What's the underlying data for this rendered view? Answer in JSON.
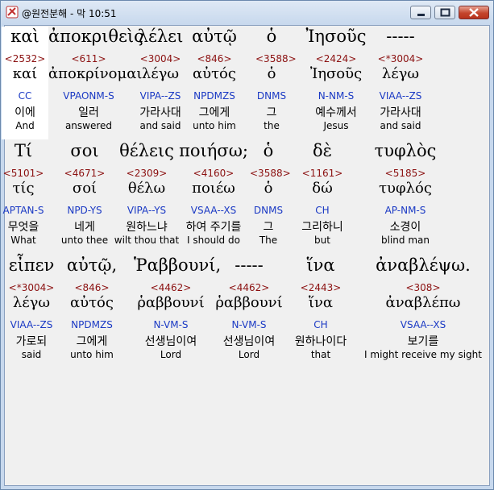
{
  "window": {
    "title": "@원전분해 - 막 10:51",
    "icon": "bible-app-icon",
    "controls": [
      "minimize-icon",
      "maximize-icon",
      "close-icon"
    ]
  },
  "rows": [
    [
      {
        "greek": "καὶ",
        "strong": "<2532>",
        "lemma": "καί",
        "parse": "CC",
        "korean": "이에",
        "english": "And"
      },
      {
        "greek": "ἀποκριθεὶς",
        "strong": "<611>",
        "lemma": "ἀποκρίνομαι",
        "parse": "VPAONM-S",
        "korean": "일러",
        "english": "answered"
      },
      {
        "greek": "λέλει",
        "strong": "<3004>",
        "lemma": "λέγω",
        "parse": "VIPA--ZS",
        "korean": "가라사대",
        "english": "and said"
      },
      {
        "greek": "αὐτῷ",
        "strong": "<846>",
        "lemma": "αὐτός",
        "parse": "NPDMZS",
        "korean": "그에게",
        "english": "unto him"
      },
      {
        "greek": "ὁ",
        "strong": "<3588>",
        "lemma": "ὁ",
        "parse": "DNMS",
        "korean": "그",
        "english": "the"
      },
      {
        "greek": "Ἰησοῦς",
        "strong": "<2424>",
        "lemma": "Ἰησοῦς",
        "parse": "N-NM-S",
        "korean": "예수께서",
        "english": "Jesus"
      },
      {
        "greek": "-----",
        "strong": "<*3004>",
        "lemma": "λέγω",
        "parse": "VIAA--ZS",
        "korean": "가라사대",
        "english": "and said"
      }
    ],
    [
      {
        "greek": "Τί",
        "strong": "<5101>",
        "lemma": "τίς",
        "parse": "APTAN-S",
        "korean": "무엇을",
        "english": "What"
      },
      {
        "greek": "σοι",
        "strong": "<4671>",
        "lemma": "σοί",
        "parse": "NPD-YS",
        "korean": "네게",
        "english": "unto thee"
      },
      {
        "greek": "θέλεις",
        "strong": "<2309>",
        "lemma": "θέλω",
        "parse": "VIPA--YS",
        "korean": "원하느냐",
        "english": "wilt thou that"
      },
      {
        "greek": "ποιήσω;",
        "strong": "<4160>",
        "lemma": "ποιέω",
        "parse": "VSAA--XS",
        "korean": "하여 주기를",
        "english": "I should do"
      },
      {
        "greek": "ὁ",
        "strong": "<3588>",
        "lemma": "ὁ",
        "parse": "DNMS",
        "korean": "그",
        "english": "The"
      },
      {
        "greek": "δὲ",
        "strong": "<1161>",
        "lemma": "δώ",
        "parse": "CH",
        "korean": "그리하니",
        "english": "but"
      },
      {
        "greek": "τυφλὸς",
        "strong": "<5185>",
        "lemma": "τυφλός",
        "parse": "AP-NM-S",
        "korean": "소경이",
        "english": "blind man"
      }
    ],
    [
      {
        "greek": "εἶπεν",
        "strong": "<*3004>",
        "lemma": "λέγω",
        "parse": "VIAA--ZS",
        "korean": "가로되",
        "english": "said"
      },
      {
        "greek": "αὐτῷ,",
        "strong": "<846>",
        "lemma": "αὐτός",
        "parse": "NPDMZS",
        "korean": "그에게",
        "english": "unto him"
      },
      {
        "greek": "Ῥαββουνί,",
        "strong": "<4462>",
        "lemma": "ῥαββουνί",
        "parse": "N-VM-S",
        "korean": "선생님이여",
        "english": "Lord"
      },
      {
        "greek": "-----",
        "strong": "<4462>",
        "lemma": "ῥαββουνί",
        "parse": "N-VM-S",
        "korean": "선생님이여",
        "english": "Lord"
      },
      {
        "greek": "ἵνα",
        "strong": "<2443>",
        "lemma": "ἵνα",
        "parse": "CH",
        "korean": "원하나이다",
        "english": "that"
      },
      {
        "greek": "ἀναβλέψω.",
        "strong": "<308>",
        "lemma": "ἀναβλέπω",
        "parse": "VSAA--XS",
        "korean": "보기를",
        "english": "I might receive my sight"
      }
    ]
  ]
}
